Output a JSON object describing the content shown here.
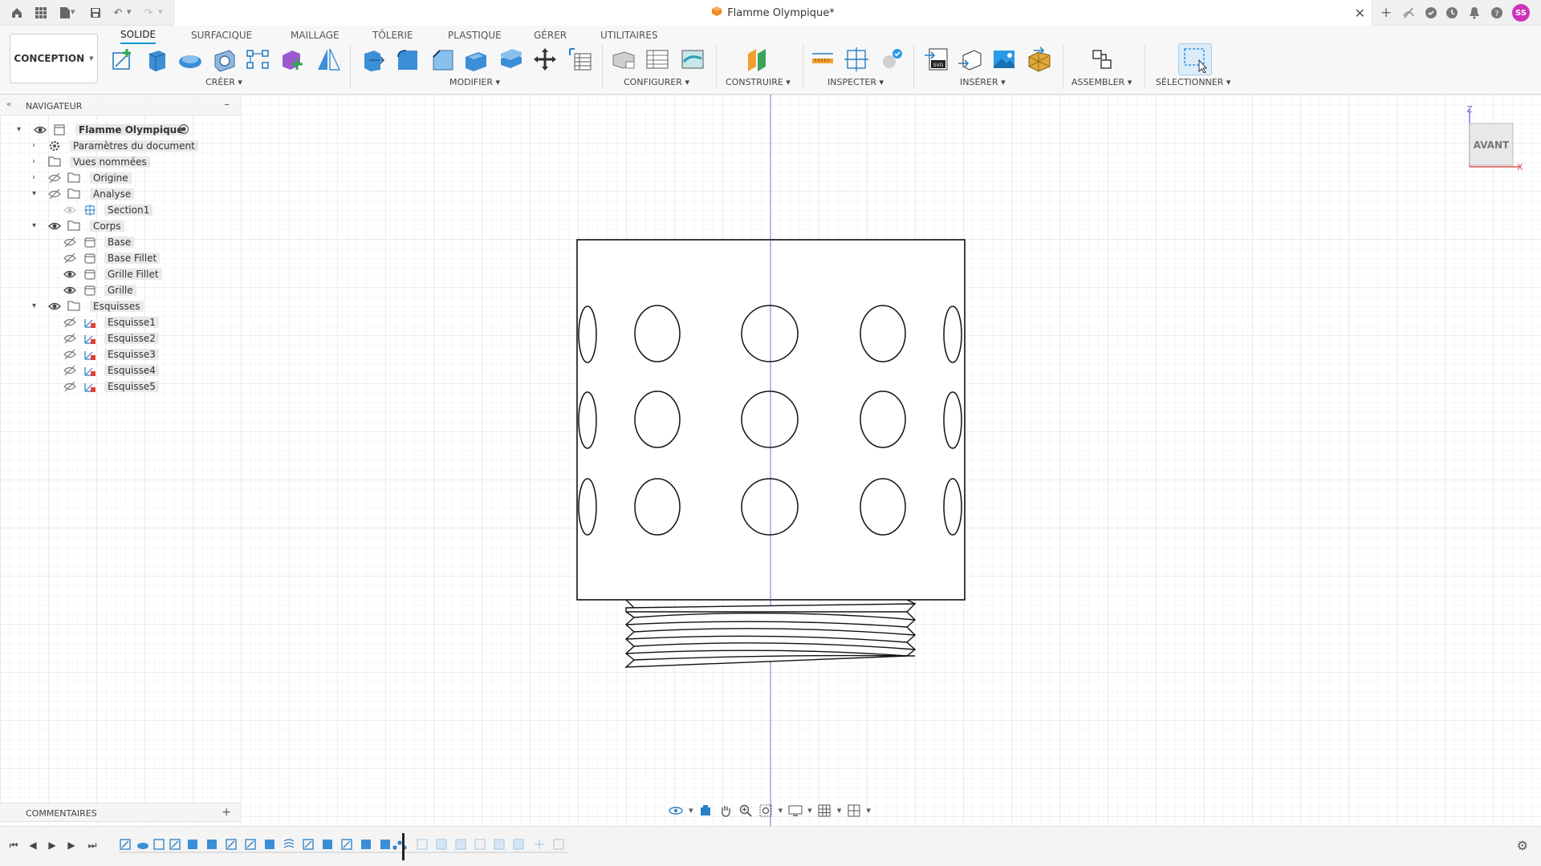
{
  "app": {
    "document_title": "Flamme Olympique*",
    "user_initials": "SS"
  },
  "ribbon": {
    "workspace": "CONCEPTION",
    "tabs": [
      "SOLIDE",
      "SURFACIQUE",
      "MAILLAGE",
      "TÔLERIE",
      "PLASTIQUE",
      "GÉRER",
      "UTILITAIRES"
    ],
    "active_tab": "SOLIDE",
    "groups": {
      "create": "CRÉER",
      "modify": "MODIFIER",
      "configure": "CONFIGURER",
      "construct": "CONSTRUIRE",
      "inspect": "INSPECTER",
      "insert": "INSÉRER",
      "assemble": "ASSEMBLER",
      "select": "SÉLECTIONNER"
    },
    "insert_svg_badge": "SVG"
  },
  "navigator": {
    "title": "NAVIGATEUR",
    "collapse": "–",
    "items": [
      {
        "label": "Flamme Olympique",
        "icon": "component-icon"
      },
      {
        "label": "Paramètres du document",
        "icon": "gear-icon"
      },
      {
        "label": "Vues nommées",
        "icon": "folder-icon"
      },
      {
        "label": "Origine",
        "icon": "folder-icon"
      },
      {
        "label": "Analyse",
        "icon": "folder-icon"
      },
      {
        "label": "Section1",
        "icon": "section-analysis-icon"
      },
      {
        "label": "Corps",
        "icon": "folder-icon"
      },
      {
        "label": "Base",
        "icon": "body-icon"
      },
      {
        "label": "Base Fillet",
        "icon": "body-icon"
      },
      {
        "label": "Grille Fillet",
        "icon": "body-icon"
      },
      {
        "label": "Grille",
        "icon": "body-icon"
      },
      {
        "label": "Esquisses",
        "icon": "folder-icon"
      },
      {
        "label": "Esquisse1",
        "icon": "sketch-icon"
      },
      {
        "label": "Esquisse2",
        "icon": "sketch-icon"
      },
      {
        "label": "Esquisse3",
        "icon": "sketch-icon"
      },
      {
        "label": "Esquisse4",
        "icon": "sketch-icon"
      },
      {
        "label": "Esquisse5",
        "icon": "sketch-icon"
      }
    ]
  },
  "viewcube": {
    "face": "AVANT",
    "axis_z": "Z",
    "axis_x": "X"
  },
  "comments": {
    "title": "COMMENTAIRES",
    "add": "+"
  },
  "colors": {
    "accent": "#0696d7",
    "grid_minor": "#e6e6e6",
    "grid_major": "#d2d2d2",
    "axis_blue": "#6f6fd8",
    "axis_red": "#e05050",
    "avatar": "#cc33bb"
  }
}
